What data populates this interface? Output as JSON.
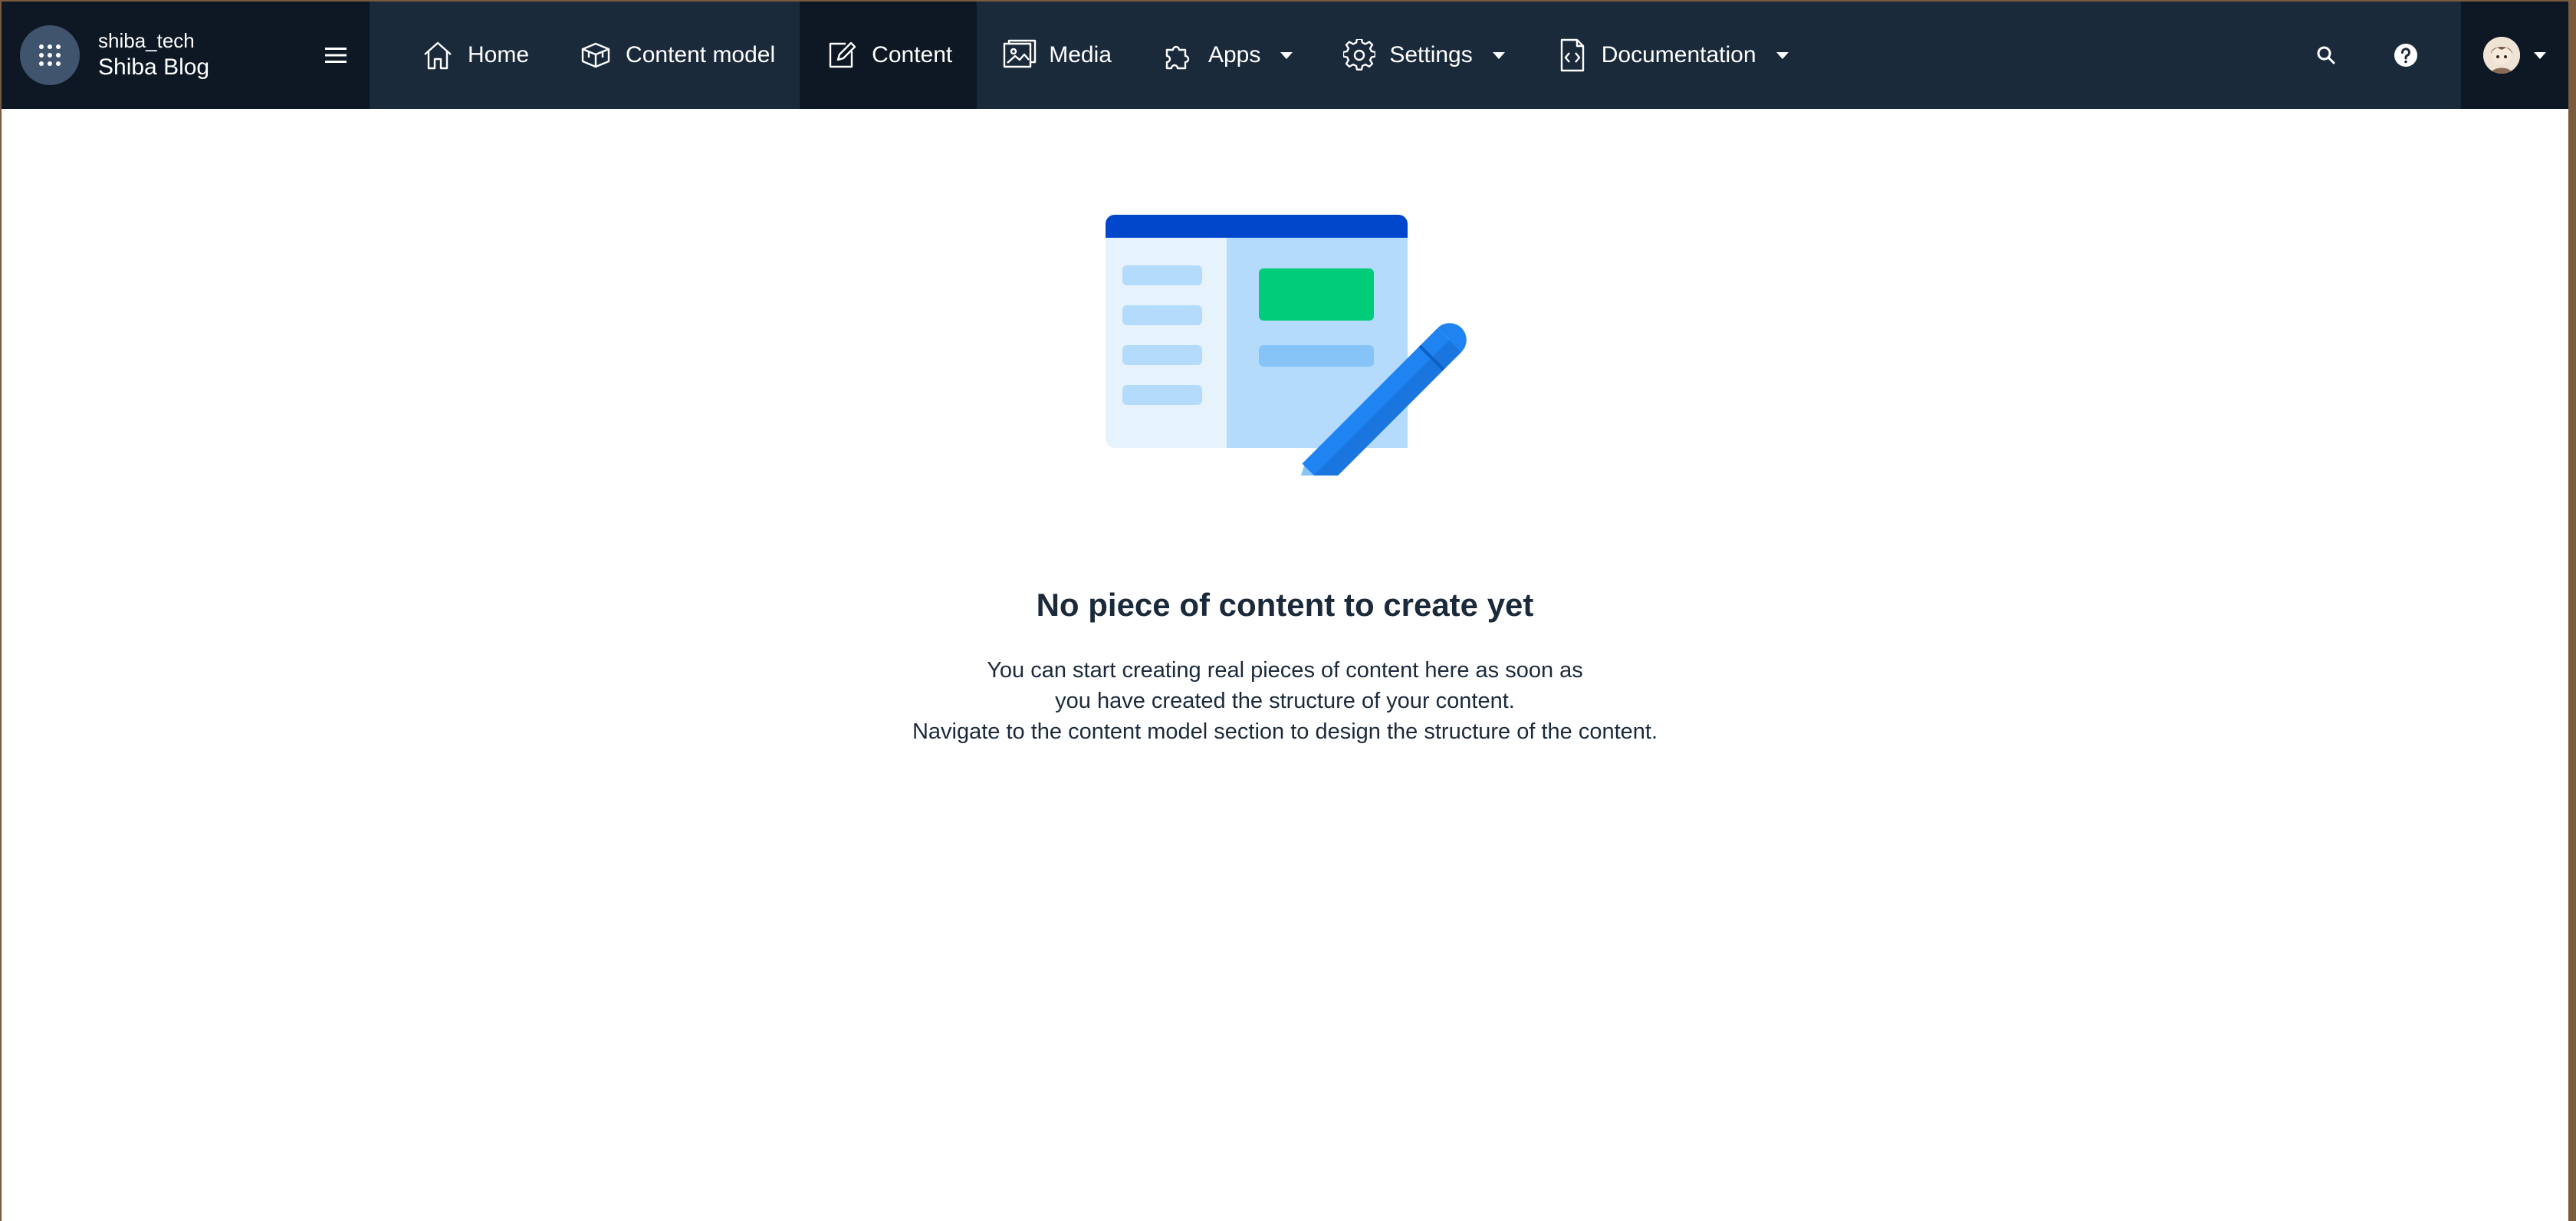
{
  "space": {
    "org_name": "shiba_tech",
    "space_name": "Shiba Blog"
  },
  "nav": {
    "items": [
      {
        "label": "Home",
        "icon": "home-icon",
        "active": false,
        "dropdown": false
      },
      {
        "label": "Content model",
        "icon": "content-model-icon",
        "active": false,
        "dropdown": false
      },
      {
        "label": "Content",
        "icon": "content-edit-icon",
        "active": true,
        "dropdown": false
      },
      {
        "label": "Media",
        "icon": "media-icon",
        "active": false,
        "dropdown": false
      },
      {
        "label": "Apps",
        "icon": "puzzle-icon",
        "active": false,
        "dropdown": true
      },
      {
        "label": "Settings",
        "icon": "gear-icon",
        "active": false,
        "dropdown": true
      },
      {
        "label": "Documentation",
        "icon": "code-document-icon",
        "active": false,
        "dropdown": true
      }
    ]
  },
  "toolbar": {
    "search_icon": "search-icon",
    "help_icon": "help-icon",
    "account_icon": "avatar"
  },
  "empty_state": {
    "title": "No piece of content to create yet",
    "description_lines": [
      "You can start creating real pieces of content here as soon as",
      "you have created the structure of your content.",
      "Navigate to the content model section to design the structure of the content."
    ]
  },
  "colors": {
    "topbar": "#1b2a3b",
    "topbar_dark": "#0d1824",
    "switcher": "#40546d",
    "illustration_primary": "#0047cc",
    "illustration_accent": "#00cc7a",
    "pencil": "#1f83f2"
  }
}
